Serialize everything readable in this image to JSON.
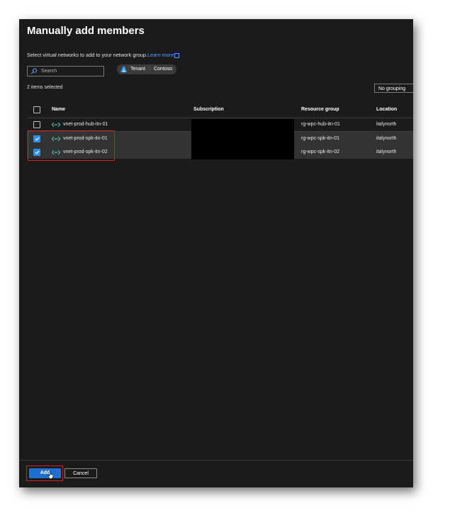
{
  "dialog": {
    "title": "Manually add members",
    "description": "Select virtual networks to add to your network group.",
    "learn_more": "Learn more"
  },
  "search": {
    "placeholder": "Search"
  },
  "tenant": {
    "label": "Tenant",
    "value": "Contoso"
  },
  "selection": {
    "count_text": "2 items selected"
  },
  "grouping": {
    "selected": "No grouping"
  },
  "table": {
    "columns": [
      "Name",
      "Subscription",
      "Resource group",
      "Location"
    ],
    "rows": [
      {
        "name": "vnet-prod-hub-itn-01",
        "subscription": "",
        "resource_group": "rg-wpc-hub-itn-01",
        "location": "italynorth",
        "checked": false
      },
      {
        "name": "vnet-prod-spk-itn-01",
        "subscription": "",
        "resource_group": "rg-wpc-spk-itn-01",
        "location": "italynorth",
        "checked": true
      },
      {
        "name": "vnet-prod-spk-itn-02",
        "subscription": "",
        "resource_group": "rg-wpc-spk-itn-02",
        "location": "italynorth",
        "checked": true
      }
    ]
  },
  "footer": {
    "add_label": "Add",
    "cancel_label": "Cancel"
  },
  "colors": {
    "accent": "#2f8fe5",
    "highlight": "#d11f26",
    "panel": "#1b1b1b",
    "link": "#4aa3ff"
  },
  "icons": {
    "search": "search-icon",
    "tenant": "azure-tenant-icon",
    "vnet": "vnet-icon",
    "cursor": "hand-cursor-icon"
  }
}
